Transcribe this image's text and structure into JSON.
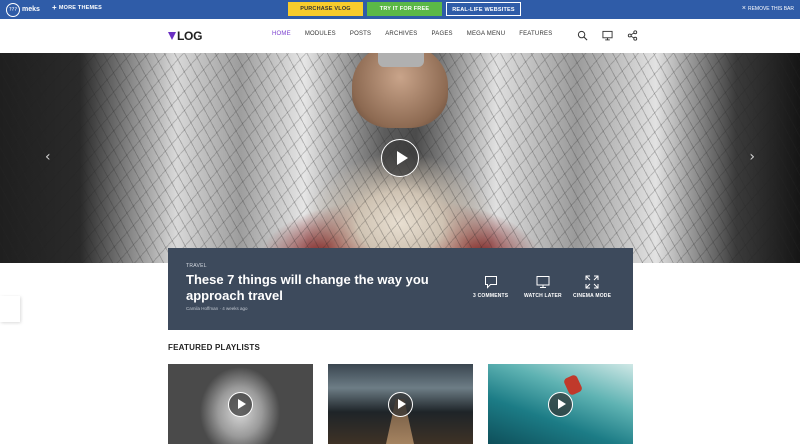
{
  "topbar": {
    "logo_mark": "???",
    "logo_text": "meks",
    "more_themes": "MORE THEMES",
    "purchase": "PURCHASE VLOG",
    "try": "TRY IT FOR FREE",
    "real_life": "REAL-LIFE WEBSITES",
    "remove": "REMOVE THIS BAR",
    "colors": {
      "bar": "#2f5ca8",
      "purchase": "#f8cc2c",
      "try": "#5bb847"
    }
  },
  "header": {
    "logo": "LOG",
    "logo_accent": "#6a2fc2",
    "nav": [
      "HOME",
      "MODULES",
      "POSTS",
      "ARCHIVES",
      "PAGES",
      "MEGA MENU",
      "FEATURES"
    ],
    "active_nav": "HOME",
    "icons": [
      "search-icon",
      "monitor-icon",
      "share-icon"
    ]
  },
  "hero": {
    "category": "TRAVEL",
    "title": "These 7 things will change the way you approach travel",
    "author": "Camila Hoffman",
    "separator": "·",
    "time": "4 weeks ago",
    "actions": {
      "comments": "3 COMMENTS",
      "watch_later": "WATCH LATER",
      "cinema": "CINEMA MODE"
    },
    "box_color": "#3d4a5c"
  },
  "featured": {
    "title": "FEATURED PLAYLISTS"
  }
}
